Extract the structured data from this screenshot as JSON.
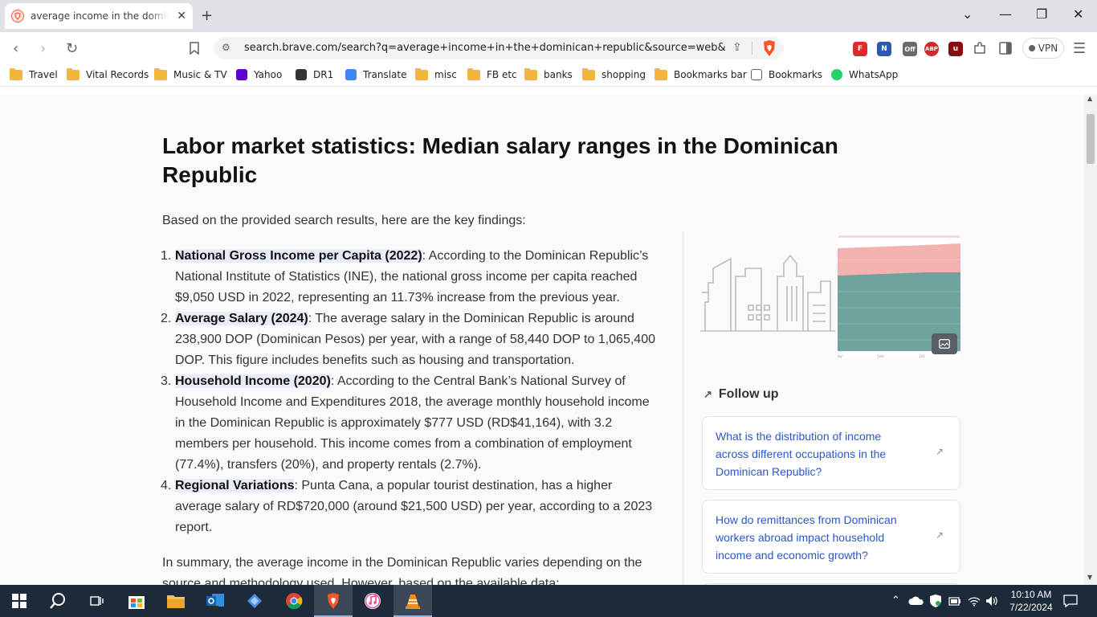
{
  "browser": {
    "tab_title": "average income in the dominican republic - Brave Search",
    "tab_close": "✕",
    "new_tab": "+",
    "url": "search.brave.com/search?q=average+income+in+the+dominican+republic&source=web&sum...",
    "vpn_label": "VPN",
    "ext_off_badge": "Off",
    "ext_abp": "ABP"
  },
  "bookmarks": [
    {
      "label": "Travel",
      "icon": "folder"
    },
    {
      "label": "Vital Records",
      "icon": "folder"
    },
    {
      "label": "Music & TV",
      "icon": "folder"
    },
    {
      "label": "Yahoo",
      "icon": "yahoo-icon"
    },
    {
      "label": "DR1",
      "icon": "dr1-icon"
    },
    {
      "label": "Translate",
      "icon": "translate-icon"
    },
    {
      "label": "misc",
      "icon": "folder"
    },
    {
      "label": "FB etc",
      "icon": "folder"
    },
    {
      "label": "banks",
      "icon": "folder"
    },
    {
      "label": "shopping",
      "icon": "folder"
    },
    {
      "label": "Bookmarks bar",
      "icon": "folder"
    },
    {
      "label": "Bookmarks",
      "icon": "bookmarks-icon"
    },
    {
      "label": "WhatsApp",
      "icon": "whatsapp-icon"
    }
  ],
  "article": {
    "heading": "Labor market statistics: Median salary ranges in the Dominican Republic",
    "intro": "Based on the provided search results, here are the key findings:",
    "findings": [
      {
        "num": "1.",
        "key": "National Gross Income per Capita (2022)",
        "text": ": According to the Dominican Republic’s National Institute of Statistics (INE), the national gross income per capita reached $9,050 USD in 2022, representing an 11.73% increase from the previous year."
      },
      {
        "num": "2.",
        "key": "Average Salary (2024)",
        "text": ": The average salary in the Dominican Republic is around 238,900 DOP (Dominican Pesos) per year, with a range of 58,440 DOP to 1,065,400 DOP. This figure includes benefits such as housing and transportation."
      },
      {
        "num": "3.",
        "key": "Household Income (2020)",
        "text": ": According to the Central Bank’s National Survey of Household Income and Expenditures 2018, the average monthly household income in the Dominican Republic is approximately $777 USD (RD$41,164), with 3.2 members per household. This income comes from a combination of employment (77.4%), transfers (20%), and property rentals (2.7%)."
      },
      {
        "num": "4.",
        "key": "Regional Variations",
        "text": ": Punta Cana, a popular tourist destination, has a higher average salary of RD$720,000 (around $21,500 USD) per year, according to a 2023 report."
      }
    ],
    "summary": "In summary, the average income in the Dominican Republic varies depending on the source and methodology used. However, based on the available data:"
  },
  "sidebar": {
    "thumb_labels": [
      "ay",
      "Jun",
      "Jul"
    ],
    "follow_up_title": "Follow up",
    "questions": [
      "What is the distribution of income across different occupations in the Dominican Republic?",
      "How do remittances from Dominican workers abroad impact household income and economic growth?"
    ]
  },
  "taskbar": {
    "time": "10:10 AM",
    "date": "7/22/2024"
  }
}
